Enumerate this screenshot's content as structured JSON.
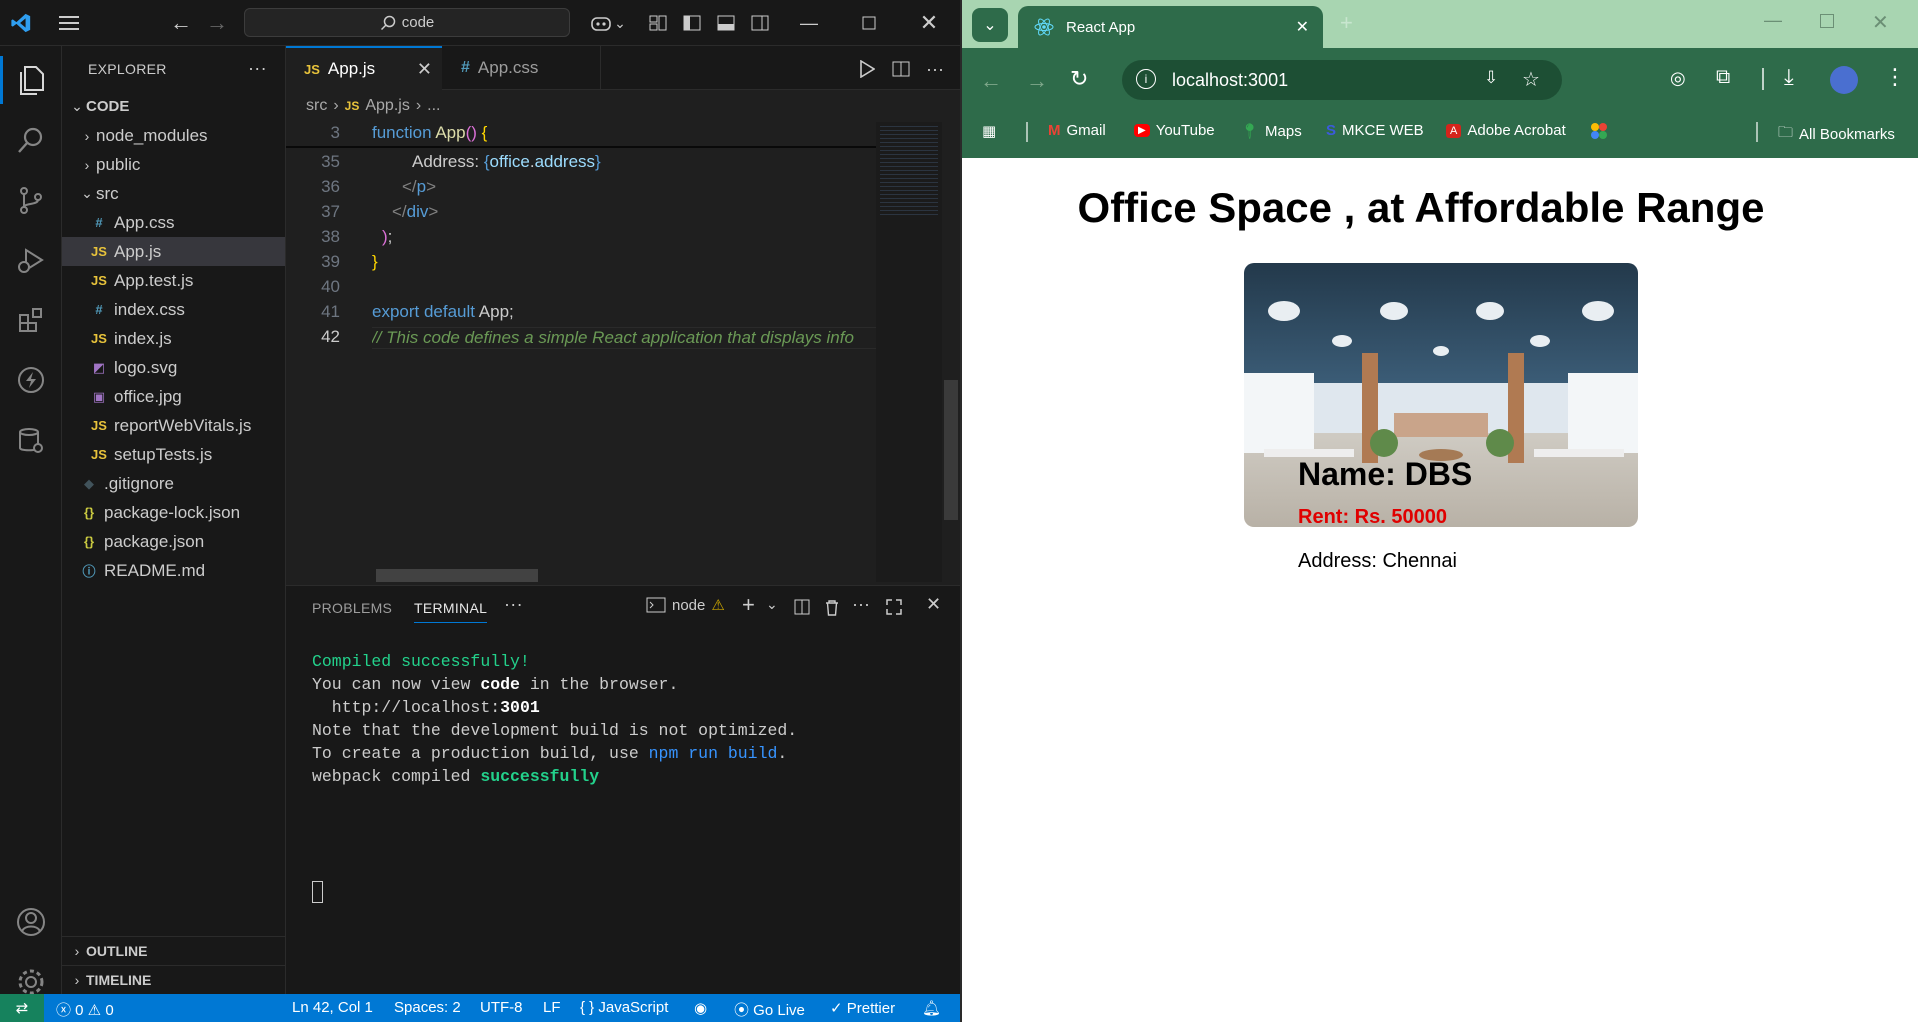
{
  "vscode": {
    "search_text": "code",
    "explorer_title": "EXPLORER",
    "folder_name": "CODE",
    "tree": [
      {
        "label": "node_modules",
        "type": "folder"
      },
      {
        "label": "public",
        "type": "folder"
      },
      {
        "label": "src",
        "type": "folder-open"
      },
      {
        "label": "App.css",
        "type": "css"
      },
      {
        "label": "App.js",
        "type": "js",
        "selected": true
      },
      {
        "label": "App.test.js",
        "type": "js"
      },
      {
        "label": "index.css",
        "type": "css"
      },
      {
        "label": "index.js",
        "type": "js"
      },
      {
        "label": "logo.svg",
        "type": "svg"
      },
      {
        "label": "office.jpg",
        "type": "img"
      },
      {
        "label": "reportWebVitals.js",
        "type": "js"
      },
      {
        "label": "setupTests.js",
        "type": "js"
      },
      {
        "label": ".gitignore",
        "type": "git"
      },
      {
        "label": "package-lock.json",
        "type": "json"
      },
      {
        "label": "package.json",
        "type": "json"
      },
      {
        "label": "README.md",
        "type": "info"
      }
    ],
    "outline_label": "OUTLINE",
    "timeline_label": "TIMELINE",
    "tabs": [
      {
        "label": "App.js",
        "icon": "JS"
      },
      {
        "label": "App.css",
        "icon": "#"
      }
    ],
    "breadcrumb": [
      "src",
      "App.js",
      "..."
    ],
    "code_lines": [
      {
        "num": "3",
        "text": "function App() {"
      },
      {
        "num": "35",
        "text": "Address: {office.address}"
      },
      {
        "num": "36",
        "text": "</p>"
      },
      {
        "num": "37",
        "text": "</div>"
      },
      {
        "num": "38",
        "text": ");"
      },
      {
        "num": "39",
        "text": "}"
      },
      {
        "num": "40",
        "text": ""
      },
      {
        "num": "41",
        "text": "export default App;"
      },
      {
        "num": "42",
        "text": "// This code defines a simple React application that displays info"
      }
    ],
    "panel_tabs": [
      "PROBLEMS",
      "TERMINAL"
    ],
    "terminal_name": "node",
    "terminal": {
      "compiled": "Compiled successfully!",
      "view_prefix": "You can now view ",
      "view_app": "code",
      "view_suffix": " in the browser.",
      "url_prefix": "  http://localhost:",
      "url_port": "3001",
      "note": "Note that the development build is not optimized.",
      "prod_prefix": "To create a production build, use ",
      "prod_cmd": "npm run build",
      "prod_suffix": ".",
      "webpack_prefix": "webpack compiled ",
      "webpack_status": "successfully"
    },
    "status": {
      "errors": "0",
      "warnings": "0",
      "position": "Ln 42, Col 1",
      "spaces": "Spaces: 2",
      "encoding": "UTF-8",
      "eol": "LF",
      "language": "JavaScript",
      "golive": "Go Live",
      "prettier": "Prettier"
    }
  },
  "browser": {
    "tab_title": "React App",
    "url": "localhost:3001",
    "bookmarks": [
      "Gmail",
      "YouTube",
      "Maps",
      "MKCE WEB",
      "Adobe Acrobat"
    ],
    "all_bookmarks": "All Bookmarks",
    "page": {
      "heading": "Office Space , at Affordable Range",
      "name": "Name: DBS",
      "rent": "Rent: Rs. 50000",
      "address": "Address: Chennai"
    }
  },
  "colors": {
    "vscode_accent": "#0078d4",
    "browser_theme": "#2e6b4a",
    "rent_red": "#e00000",
    "terminal_green": "#23d18b"
  }
}
